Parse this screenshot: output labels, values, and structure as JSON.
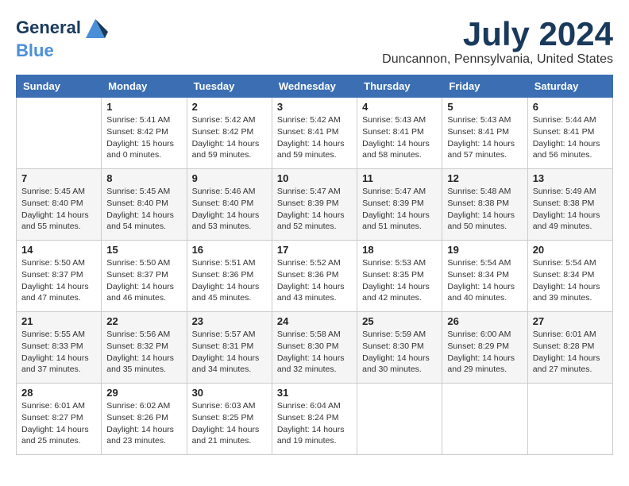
{
  "header": {
    "logo_line1": "General",
    "logo_line2": "Blue",
    "month_year": "July 2024",
    "location": "Duncannon, Pennsylvania, United States"
  },
  "weekdays": [
    "Sunday",
    "Monday",
    "Tuesday",
    "Wednesday",
    "Thursday",
    "Friday",
    "Saturday"
  ],
  "weeks": [
    [
      {
        "day": "",
        "sunrise": "",
        "sunset": "",
        "daylight": ""
      },
      {
        "day": "1",
        "sunrise": "Sunrise: 5:41 AM",
        "sunset": "Sunset: 8:42 PM",
        "daylight": "Daylight: 15 hours and 0 minutes."
      },
      {
        "day": "2",
        "sunrise": "Sunrise: 5:42 AM",
        "sunset": "Sunset: 8:42 PM",
        "daylight": "Daylight: 14 hours and 59 minutes."
      },
      {
        "day": "3",
        "sunrise": "Sunrise: 5:42 AM",
        "sunset": "Sunset: 8:41 PM",
        "daylight": "Daylight: 14 hours and 59 minutes."
      },
      {
        "day": "4",
        "sunrise": "Sunrise: 5:43 AM",
        "sunset": "Sunset: 8:41 PM",
        "daylight": "Daylight: 14 hours and 58 minutes."
      },
      {
        "day": "5",
        "sunrise": "Sunrise: 5:43 AM",
        "sunset": "Sunset: 8:41 PM",
        "daylight": "Daylight: 14 hours and 57 minutes."
      },
      {
        "day": "6",
        "sunrise": "Sunrise: 5:44 AM",
        "sunset": "Sunset: 8:41 PM",
        "daylight": "Daylight: 14 hours and 56 minutes."
      }
    ],
    [
      {
        "day": "7",
        "sunrise": "Sunrise: 5:45 AM",
        "sunset": "Sunset: 8:40 PM",
        "daylight": "Daylight: 14 hours and 55 minutes."
      },
      {
        "day": "8",
        "sunrise": "Sunrise: 5:45 AM",
        "sunset": "Sunset: 8:40 PM",
        "daylight": "Daylight: 14 hours and 54 minutes."
      },
      {
        "day": "9",
        "sunrise": "Sunrise: 5:46 AM",
        "sunset": "Sunset: 8:40 PM",
        "daylight": "Daylight: 14 hours and 53 minutes."
      },
      {
        "day": "10",
        "sunrise": "Sunrise: 5:47 AM",
        "sunset": "Sunset: 8:39 PM",
        "daylight": "Daylight: 14 hours and 52 minutes."
      },
      {
        "day": "11",
        "sunrise": "Sunrise: 5:47 AM",
        "sunset": "Sunset: 8:39 PM",
        "daylight": "Daylight: 14 hours and 51 minutes."
      },
      {
        "day": "12",
        "sunrise": "Sunrise: 5:48 AM",
        "sunset": "Sunset: 8:38 PM",
        "daylight": "Daylight: 14 hours and 50 minutes."
      },
      {
        "day": "13",
        "sunrise": "Sunrise: 5:49 AM",
        "sunset": "Sunset: 8:38 PM",
        "daylight": "Daylight: 14 hours and 49 minutes."
      }
    ],
    [
      {
        "day": "14",
        "sunrise": "Sunrise: 5:50 AM",
        "sunset": "Sunset: 8:37 PM",
        "daylight": "Daylight: 14 hours and 47 minutes."
      },
      {
        "day": "15",
        "sunrise": "Sunrise: 5:50 AM",
        "sunset": "Sunset: 8:37 PM",
        "daylight": "Daylight: 14 hours and 46 minutes."
      },
      {
        "day": "16",
        "sunrise": "Sunrise: 5:51 AM",
        "sunset": "Sunset: 8:36 PM",
        "daylight": "Daylight: 14 hours and 45 minutes."
      },
      {
        "day": "17",
        "sunrise": "Sunrise: 5:52 AM",
        "sunset": "Sunset: 8:36 PM",
        "daylight": "Daylight: 14 hours and 43 minutes."
      },
      {
        "day": "18",
        "sunrise": "Sunrise: 5:53 AM",
        "sunset": "Sunset: 8:35 PM",
        "daylight": "Daylight: 14 hours and 42 minutes."
      },
      {
        "day": "19",
        "sunrise": "Sunrise: 5:54 AM",
        "sunset": "Sunset: 8:34 PM",
        "daylight": "Daylight: 14 hours and 40 minutes."
      },
      {
        "day": "20",
        "sunrise": "Sunrise: 5:54 AM",
        "sunset": "Sunset: 8:34 PM",
        "daylight": "Daylight: 14 hours and 39 minutes."
      }
    ],
    [
      {
        "day": "21",
        "sunrise": "Sunrise: 5:55 AM",
        "sunset": "Sunset: 8:33 PM",
        "daylight": "Daylight: 14 hours and 37 minutes."
      },
      {
        "day": "22",
        "sunrise": "Sunrise: 5:56 AM",
        "sunset": "Sunset: 8:32 PM",
        "daylight": "Daylight: 14 hours and 35 minutes."
      },
      {
        "day": "23",
        "sunrise": "Sunrise: 5:57 AM",
        "sunset": "Sunset: 8:31 PM",
        "daylight": "Daylight: 14 hours and 34 minutes."
      },
      {
        "day": "24",
        "sunrise": "Sunrise: 5:58 AM",
        "sunset": "Sunset: 8:30 PM",
        "daylight": "Daylight: 14 hours and 32 minutes."
      },
      {
        "day": "25",
        "sunrise": "Sunrise: 5:59 AM",
        "sunset": "Sunset: 8:30 PM",
        "daylight": "Daylight: 14 hours and 30 minutes."
      },
      {
        "day": "26",
        "sunrise": "Sunrise: 6:00 AM",
        "sunset": "Sunset: 8:29 PM",
        "daylight": "Daylight: 14 hours and 29 minutes."
      },
      {
        "day": "27",
        "sunrise": "Sunrise: 6:01 AM",
        "sunset": "Sunset: 8:28 PM",
        "daylight": "Daylight: 14 hours and 27 minutes."
      }
    ],
    [
      {
        "day": "28",
        "sunrise": "Sunrise: 6:01 AM",
        "sunset": "Sunset: 8:27 PM",
        "daylight": "Daylight: 14 hours and 25 minutes."
      },
      {
        "day": "29",
        "sunrise": "Sunrise: 6:02 AM",
        "sunset": "Sunset: 8:26 PM",
        "daylight": "Daylight: 14 hours and 23 minutes."
      },
      {
        "day": "30",
        "sunrise": "Sunrise: 6:03 AM",
        "sunset": "Sunset: 8:25 PM",
        "daylight": "Daylight: 14 hours and 21 minutes."
      },
      {
        "day": "31",
        "sunrise": "Sunrise: 6:04 AM",
        "sunset": "Sunset: 8:24 PM",
        "daylight": "Daylight: 14 hours and 19 minutes."
      },
      {
        "day": "",
        "sunrise": "",
        "sunset": "",
        "daylight": ""
      },
      {
        "day": "",
        "sunrise": "",
        "sunset": "",
        "daylight": ""
      },
      {
        "day": "",
        "sunrise": "",
        "sunset": "",
        "daylight": ""
      }
    ]
  ]
}
